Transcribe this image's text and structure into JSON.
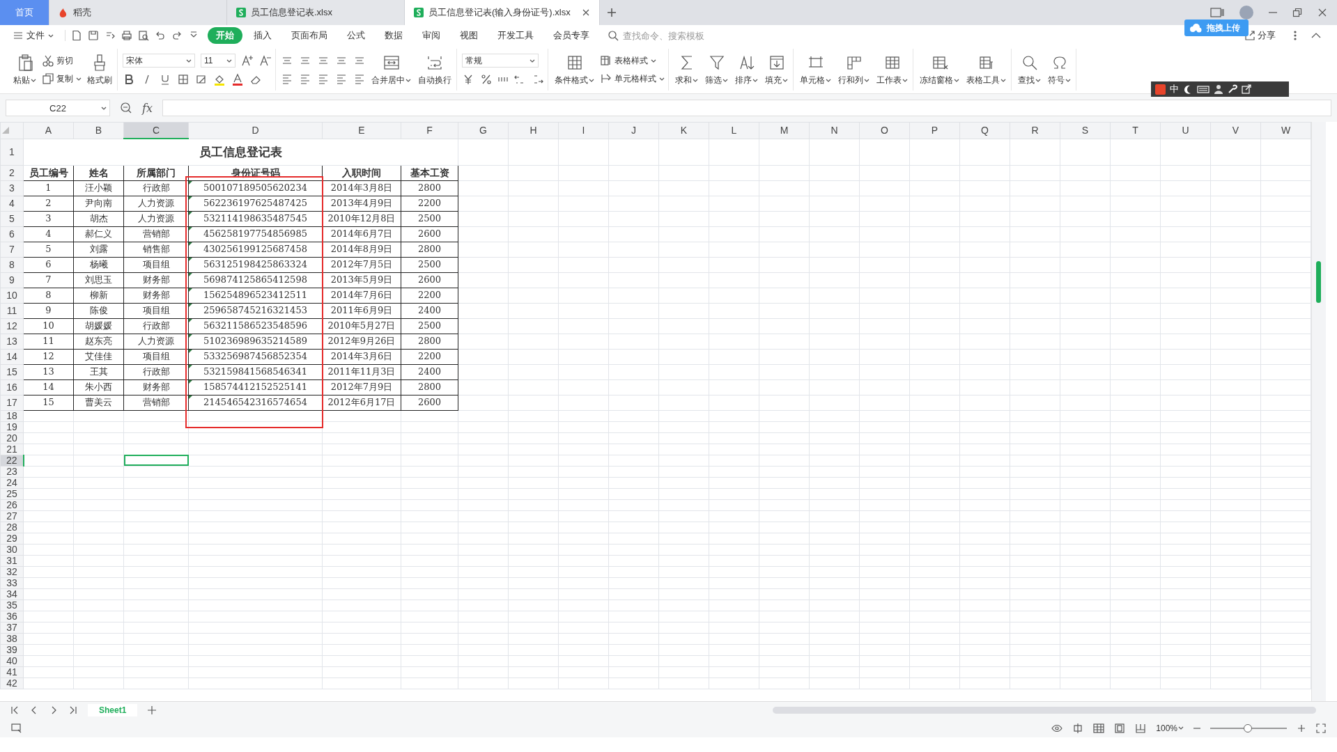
{
  "title_tabs": [
    {
      "label": "首页",
      "kind": "home",
      "selected": false
    },
    {
      "label": "稻壳",
      "kind": "docer",
      "selected": false
    },
    {
      "label": "员工信息登记表.xlsx",
      "kind": "sheet",
      "selected": false
    },
    {
      "label": "员工信息登记表(输入身份证号).xlsx",
      "kind": "sheet",
      "selected": true
    }
  ],
  "upload_tip": "拖拽上传",
  "menu": {
    "file": "文件",
    "tabs": [
      {
        "label": "开始",
        "selected": true
      },
      {
        "label": "插入",
        "selected": false
      },
      {
        "label": "页面布局",
        "selected": false
      },
      {
        "label": "公式",
        "selected": false
      },
      {
        "label": "数据",
        "selected": false
      },
      {
        "label": "审阅",
        "selected": false
      },
      {
        "label": "视图",
        "selected": false
      },
      {
        "label": "开发工具",
        "selected": false
      },
      {
        "label": "会员专享",
        "selected": false
      }
    ],
    "search": {
      "placeholder": "查找命令、搜索模板"
    },
    "share": "分享"
  },
  "ribbon": {
    "paste": "粘贴",
    "cut": "剪切",
    "copy": "复制",
    "format_painter": "格式刷",
    "font_name": "宋体",
    "font_size": "11",
    "merge": "合并居中",
    "wrap": "自动换行",
    "number_format": "常规",
    "conditional": "条件格式",
    "table_style": "表格样式",
    "cell_style": "单元格样式",
    "tools": [
      "求和",
      "筛选",
      "排序",
      "填充",
      "单元格",
      "行和列",
      "工作表",
      "冻结窗格",
      "表格工具",
      "查找",
      "符号"
    ]
  },
  "ime_bar": {
    "mode": "中"
  },
  "formula_bar": {
    "name_box": "C22",
    "fx": "fx"
  },
  "grid": {
    "columns": [
      {
        "label": "A",
        "selected": false
      },
      {
        "label": "B",
        "selected": false
      },
      {
        "label": "C",
        "selected": true
      },
      {
        "label": "D",
        "selected": false,
        "highlighted": true,
        "text_numbers": true
      },
      {
        "label": "E",
        "selected": false
      },
      {
        "label": "F",
        "selected": false
      },
      {
        "label": "G",
        "selected": false
      },
      {
        "label": "H",
        "selected": false
      },
      {
        "label": "I",
        "selected": false
      },
      {
        "label": "J",
        "selected": false
      },
      {
        "label": "K",
        "selected": false
      },
      {
        "label": "L",
        "selected": false
      },
      {
        "label": "M",
        "selected": false
      },
      {
        "label": "N",
        "selected": false
      },
      {
        "label": "O",
        "selected": false
      },
      {
        "label": "P",
        "selected": false
      },
      {
        "label": "Q",
        "selected": false
      },
      {
        "label": "R",
        "selected": false
      },
      {
        "label": "S",
        "selected": false
      },
      {
        "label": "T",
        "selected": false
      },
      {
        "label": "U",
        "selected": false
      },
      {
        "label": "V",
        "selected": false
      },
      {
        "label": "W",
        "selected": false
      }
    ],
    "row_headers": [
      {
        "label": "1",
        "selected": false
      },
      {
        "label": "2",
        "selected": false
      },
      {
        "label": "3",
        "selected": false
      },
      {
        "label": "4",
        "selected": false
      },
      {
        "label": "5",
        "selected": false
      },
      {
        "label": "6",
        "selected": false
      },
      {
        "label": "7",
        "selected": false
      },
      {
        "label": "8",
        "selected": false
      },
      {
        "label": "9",
        "selected": false
      },
      {
        "label": "10",
        "selected": false
      },
      {
        "label": "11",
        "selected": false
      },
      {
        "label": "12",
        "selected": false
      },
      {
        "label": "13",
        "selected": false
      },
      {
        "label": "14",
        "selected": false
      },
      {
        "label": "15",
        "selected": false
      },
      {
        "label": "16",
        "selected": false
      },
      {
        "label": "17",
        "selected": false
      },
      {
        "label": "18",
        "selected": false
      },
      {
        "label": "19",
        "selected": false
      },
      {
        "label": "20",
        "selected": false
      },
      {
        "label": "21",
        "selected": false
      },
      {
        "label": "22",
        "selected": true
      },
      {
        "label": "23",
        "selected": false
      },
      {
        "label": "24",
        "selected": false
      },
      {
        "label": "25",
        "selected": false
      },
      {
        "label": "26",
        "selected": false
      },
      {
        "label": "27",
        "selected": false
      },
      {
        "label": "28",
        "selected": false
      },
      {
        "label": "29",
        "selected": false
      },
      {
        "label": "30",
        "selected": false
      },
      {
        "label": "31",
        "selected": false
      },
      {
        "label": "32",
        "selected": false
      },
      {
        "label": "33",
        "selected": false
      },
      {
        "label": "34",
        "selected": false
      },
      {
        "label": "35",
        "selected": false
      },
      {
        "label": "36",
        "selected": false
      },
      {
        "label": "37",
        "selected": false
      },
      {
        "label": "38",
        "selected": false
      },
      {
        "label": "39",
        "selected": false
      },
      {
        "label": "40",
        "selected": false
      },
      {
        "label": "41",
        "selected": false
      },
      {
        "label": "42",
        "selected": false
      }
    ],
    "title": "员工信息登记表",
    "header": [
      "员工编号",
      "姓名",
      "所属部门",
      "身份证号码",
      "入职时间",
      "基本工资"
    ],
    "rows": [
      [
        "1",
        "汪小颖",
        "行政部",
        "500107189505620234",
        "2014年3月8日",
        "2800"
      ],
      [
        "2",
        "尹向南",
        "人力资源",
        "562236197625487425",
        "2013年4月9日",
        "2200"
      ],
      [
        "3",
        "胡杰",
        "人力资源",
        "532114198635487545",
        "2010年12月8日",
        "2500"
      ],
      [
        "4",
        "郝仁义",
        "营销部",
        "456258197754856985",
        "2014年6月7日",
        "2600"
      ],
      [
        "5",
        "刘露",
        "销售部",
        "430256199125687458",
        "2014年8月9日",
        "2800"
      ],
      [
        "6",
        "杨曦",
        "项目组",
        "563125198425863324",
        "2012年7月5日",
        "2500"
      ],
      [
        "7",
        "刘思玉",
        "财务部",
        "569874125865412598",
        "2013年5月9日",
        "2600"
      ],
      [
        "8",
        "柳新",
        "财务部",
        "156254896523412511",
        "2014年7月6日",
        "2200"
      ],
      [
        "9",
        "陈俊",
        "项目组",
        "259658745216321453",
        "2011年6月9日",
        "2400"
      ],
      [
        "10",
        "胡媛媛",
        "行政部",
        "563211586523548596",
        "2010年5月27日",
        "2500"
      ],
      [
        "11",
        "赵东亮",
        "人力资源",
        "510236989635214589",
        "2012年9月26日",
        "2800"
      ],
      [
        "12",
        "艾佳佳",
        "项目组",
        "533256987456852354",
        "2014年3月6日",
        "2200"
      ],
      [
        "13",
        "王其",
        "行政部",
        "532159841568546341",
        "2011年11月3日",
        "2400"
      ],
      [
        "14",
        "朱小西",
        "财务部",
        "158574412152525141",
        "2012年7月9日",
        "2800"
      ],
      [
        "15",
        "曹美云",
        "营销部",
        "214546542316574654",
        "2012年6月17日",
        "2600"
      ]
    ]
  },
  "sheet_tabs": [
    {
      "label": "Sheet1",
      "selected": true
    }
  ],
  "status_bar": {
    "zoom": "100%",
    "zoom_slider": {
      "level": 0.49
    }
  }
}
